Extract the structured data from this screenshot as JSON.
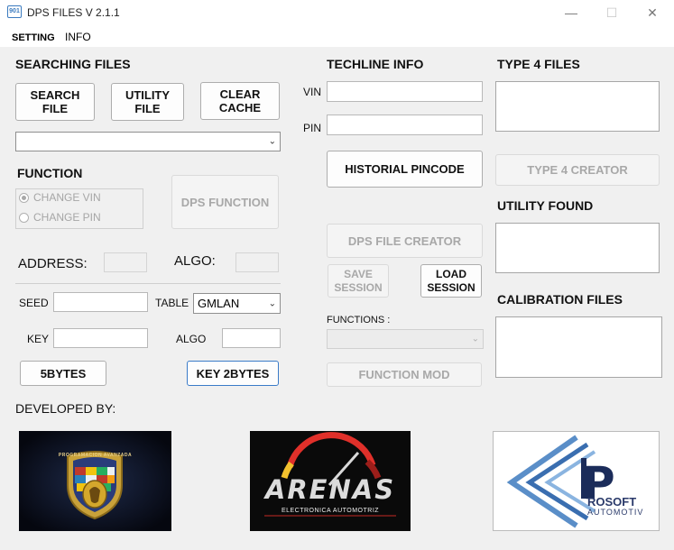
{
  "window": {
    "icon_text": "901",
    "title": "DPS FILES V 2.1.1",
    "minimize": "—",
    "maximize": "☐",
    "close": "✕"
  },
  "menu": {
    "setting": "SETTING",
    "info": "INFO"
  },
  "searching": {
    "heading": "SEARCHING FILES",
    "search_line1": "SEARCH",
    "search_line2": "FILE",
    "utility_line1": "UTILITY",
    "utility_line2": "FILE",
    "clear_line1": "CLEAR",
    "clear_line2": "CACHE",
    "file_combo_value": ""
  },
  "function": {
    "heading": "FUNCTION",
    "change_vin": "CHANGE VIN",
    "change_pin": "CHANGE PIN",
    "dps_function": "DPS FUNCTION"
  },
  "address": {
    "address_label": "ADDRESS:",
    "algo_label": "ALGO:"
  },
  "seed": {
    "seed_label": "SEED",
    "table_label": "TABLE",
    "table_value": "GMLAN",
    "key_label": "KEY",
    "algo_label": "ALGO",
    "btn_5bytes": "5BYTES",
    "btn_key2bytes": "KEY 2BYTES"
  },
  "developed_by": "DEVELOPED BY:",
  "techline": {
    "heading": "TECHLINE INFO",
    "vin_label": "VIN",
    "pin_label": "PIN",
    "historial": "HISTORIAL PINCODE",
    "dps_file_creator": "DPS FILE CREATOR",
    "save_line1": "SAVE",
    "save_line2": "SESSION",
    "load_line1": "LOAD",
    "load_line2": "SESSION",
    "functions_label": "FUNCTIONS :",
    "function_mod": "FUNCTION MOD"
  },
  "type4": {
    "heading": "TYPE 4 FILES",
    "creator": "TYPE 4 CREATOR",
    "utility_found": "UTILITY FOUND",
    "calibration_files": "CALIBRATION FILES"
  },
  "logos": {
    "logo1_text": "PROGRAMACION AVANZADA",
    "logo2_main": "ARENAS",
    "logo2_sub": "ELECTRONICA AUTOMOTRIZ",
    "logo3_main": "ROSOFT",
    "logo3_sub": "AUTOMOTIV"
  }
}
